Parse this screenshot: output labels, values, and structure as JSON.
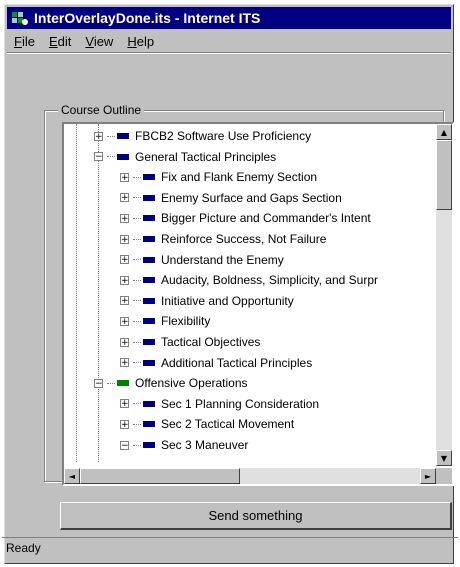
{
  "window": {
    "title": "InterOverlayDone.its - Internet ITS"
  },
  "menu": {
    "items": [
      {
        "label": "File",
        "accel": "F",
        "rest": "ile"
      },
      {
        "label": "Edit",
        "accel": "E",
        "rest": "dit"
      },
      {
        "label": "View",
        "accel": "V",
        "rest": "iew"
      },
      {
        "label": "Help",
        "accel": "H",
        "rest": "elp"
      }
    ]
  },
  "outline": {
    "label": "Course Outline",
    "items": [
      {
        "label": "FBCB2 Software Use Proficiency",
        "level": 1,
        "expander": "+",
        "icon_color": "#000080"
      },
      {
        "label": "General Tactical Principles",
        "level": 1,
        "expander": "−",
        "icon_color": "#000080"
      },
      {
        "label": "Fix and Flank Enemy Section",
        "level": 2,
        "expander": "+",
        "icon_color": "#000080"
      },
      {
        "label": "Enemy Surface and Gaps Section",
        "level": 2,
        "expander": "+",
        "icon_color": "#000080"
      },
      {
        "label": "Bigger Picture and Commander's Intent",
        "level": 2,
        "expander": "+",
        "icon_color": "#000080"
      },
      {
        "label": "Reinforce Success, Not Failure",
        "level": 2,
        "expander": "+",
        "icon_color": "#000080"
      },
      {
        "label": "Understand the Enemy",
        "level": 2,
        "expander": "+",
        "icon_color": "#000080"
      },
      {
        "label": "Audacity, Boldness, Simplicity, and Surpr",
        "level": 2,
        "expander": "+",
        "icon_color": "#000080"
      },
      {
        "label": "Initiative and Opportunity",
        "level": 2,
        "expander": "+",
        "icon_color": "#000080"
      },
      {
        "label": "Flexibility",
        "level": 2,
        "expander": "+",
        "icon_color": "#000080"
      },
      {
        "label": "Tactical Objectives",
        "level": 2,
        "expander": "+",
        "icon_color": "#000080"
      },
      {
        "label": "Additional Tactical Principles",
        "level": 2,
        "expander": "+",
        "icon_color": "#000080"
      },
      {
        "label": "Offensive Operations",
        "level": 1,
        "expander": "−",
        "icon_color": "#008000"
      },
      {
        "label": "Sec 1 Planning Consideration",
        "level": 2,
        "expander": "+",
        "icon_color": "#000080"
      },
      {
        "label": "Sec 2 Tactical Movement",
        "level": 2,
        "expander": "+",
        "icon_color": "#000080"
      },
      {
        "label": "Sec 3 Maneuver",
        "level": 2,
        "expander": "−",
        "icon_color": "#000080"
      }
    ]
  },
  "send_button": {
    "label": "Send something"
  },
  "status": {
    "text": "Ready"
  }
}
